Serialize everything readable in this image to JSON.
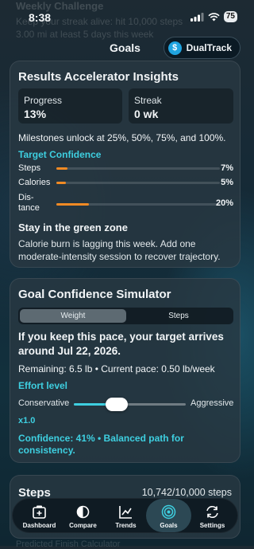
{
  "status_bar": {
    "time": "8:38",
    "battery": "75"
  },
  "background_text": {
    "line1": "Weekly Challenge",
    "line2": "Keep your streak alive: hit 10,000 steps",
    "line3": "3.00 mi at least 5 days this week",
    "line4": "Predicted Finish Calculator"
  },
  "header": {
    "title": "Goals",
    "brand_button": "DualTrack",
    "brand_icon": "$"
  },
  "insights": {
    "title": "Results Accelerator Insights",
    "progress_label": "Progress",
    "progress_value": "13%",
    "streak_label": "Streak",
    "streak_value": "0 wk",
    "milestones": "Milestones unlock at 25%, 50%, 75%, and 100%.",
    "confidence_heading": "Target Confidence",
    "rows": [
      {
        "name": "Steps",
        "pct_label": "7%",
        "fraction": 0.07
      },
      {
        "name": "Calories",
        "pct_label": "5%",
        "fraction": 0.05
      },
      {
        "name": "Dis-\ntance",
        "pct_label": "20%",
        "fraction": 0.2
      }
    ],
    "zone_title": "Stay in the green zone",
    "zone_body": "Calorie burn is lagging this week. Add one moderate-intensity session to recover trajectory."
  },
  "simulator": {
    "title": "Goal Confidence Simulator",
    "tabs": [
      "Weight",
      "Steps"
    ],
    "active_tab": "Weight",
    "projection": "If you keep this pace, your target arrives around Jul 22, 2026.",
    "remaining": "Remaining: 6.5 lb • Current pace: 0.50 lb/week",
    "effort_label": "Effort level",
    "slider_left": "Conservative",
    "slider_right": "Aggressive",
    "slider_level": 0.38,
    "multiplier": "x1.0",
    "confidence": "Confidence: 41% • Balanced path for consistency."
  },
  "steps_card": {
    "title": "Steps",
    "value": "10,742/10,000 steps"
  },
  "nav": {
    "items": [
      {
        "label": "Dashboard",
        "icon": "dashboard-icon"
      },
      {
        "label": "Compare",
        "icon": "compare-icon"
      },
      {
        "label": "Trends",
        "icon": "trends-icon"
      },
      {
        "label": "Goals",
        "icon": "goals-target-icon"
      },
      {
        "label": "Settings",
        "icon": "settings-sync-icon"
      }
    ],
    "active": "Goals"
  },
  "colors": {
    "accent": "#3ecfe0",
    "progress_fill": "#f08a24",
    "card_bg": "#283842"
  }
}
